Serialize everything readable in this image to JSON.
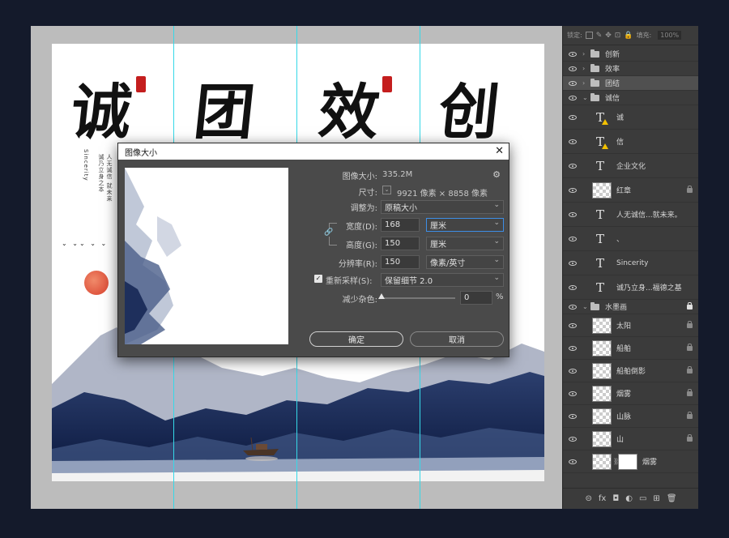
{
  "canvas": {
    "calligraphy": [
      "诚",
      "团",
      "效",
      "创"
    ],
    "subtitle": "Sincerity",
    "vertical_text_1": "诚乃立身之本",
    "vertical_text_2": "人无诚信 就未来"
  },
  "dialog": {
    "title": "图像大小",
    "close_glyph": "✕",
    "image_size_label": "图像大小:",
    "image_size_value": "335.2M",
    "dimensions_label": "尺寸:",
    "dimensions_value": "9921 像素 × 8858 像素",
    "fit_to_label": "调整为:",
    "fit_to_value": "原稿大小",
    "width_label": "宽度(D):",
    "width_value": "168",
    "width_unit": "厘米",
    "height_label": "高度(G):",
    "height_value": "150",
    "height_unit": "厘米",
    "resolution_label": "分辨率(R):",
    "resolution_value": "150",
    "resolution_unit": "像素/英寸",
    "resample_label": "重新采样(S):",
    "resample_value": "保留细节 2.0",
    "noise_label": "减少杂色:",
    "noise_value": "0",
    "noise_unit": "%",
    "ok_label": "确定",
    "cancel_label": "取消",
    "link_glyph": "🔗",
    "gear_glyph": "⚙"
  },
  "layers_panel": {
    "lock_label": "锁定:",
    "fill_label": "填充:",
    "fill_value": "100%",
    "layers": [
      {
        "name": "创新",
        "type": "group",
        "collapsed": true
      },
      {
        "name": "效率",
        "type": "group",
        "collapsed": true
      },
      {
        "name": "团结",
        "type": "group",
        "collapsed": true,
        "selected": true
      },
      {
        "name": "诚信",
        "type": "group",
        "collapsed": false
      },
      {
        "name": "诚",
        "type": "text",
        "warning": true
      },
      {
        "name": "信",
        "type": "text",
        "warning": true
      },
      {
        "name": "企业文化",
        "type": "text"
      },
      {
        "name": "红章",
        "type": "image",
        "locked": true
      },
      {
        "name": "人无诚信...就未来。",
        "type": "text"
      },
      {
        "name": "、",
        "type": "text"
      },
      {
        "name": "Sincerity",
        "type": "text"
      },
      {
        "name": "诚乃立身...福德之基",
        "type": "text"
      },
      {
        "name": "水墨画",
        "type": "group",
        "collapsed": false,
        "locked_white": true
      },
      {
        "name": "太阳",
        "type": "image",
        "locked": true
      },
      {
        "name": "船舶",
        "type": "image",
        "locked": true
      },
      {
        "name": "船舶倒影",
        "type": "image",
        "locked": true
      },
      {
        "name": "烟雾",
        "type": "image",
        "locked": true
      },
      {
        "name": "山脉",
        "type": "image",
        "locked": true
      },
      {
        "name": "山",
        "type": "image",
        "locked": true
      },
      {
        "name": "烟雾",
        "type": "masked",
        "locked": false
      }
    ],
    "footer_icons": [
      "link-icon",
      "fx-icon",
      "mask-icon",
      "adjustment-icon",
      "group-icon",
      "new-layer-icon",
      "delete-icon"
    ],
    "footer_glyphs": [
      "⊝",
      "fx",
      "◘",
      "◐",
      "▭",
      "⊞",
      "🗑"
    ]
  },
  "colors": {
    "accent": "#3d8ee6",
    "guide": "#35d9e8",
    "seal": "#c41e1e",
    "warning": "#f2c000"
  }
}
